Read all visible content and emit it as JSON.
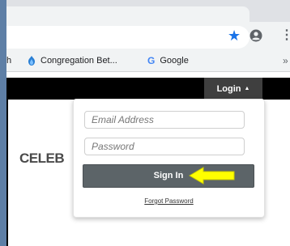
{
  "browser": {
    "bookmarks": {
      "truncated_item": "h",
      "items": [
        {
          "label": "Congregation Bet...",
          "icon": "congregation-flame-icon"
        },
        {
          "label": "Google",
          "icon": "google-g-icon"
        }
      ],
      "overflow": "»"
    },
    "toolbar": {
      "star_icon": "bookmark-star-icon",
      "profile_icon": "account-circle-icon",
      "menu_icon": "kebab-menu-icon"
    }
  },
  "site": {
    "nav": {
      "login_label": "Login",
      "login_caret": "▲"
    },
    "headline": "CELEB"
  },
  "login_dropdown": {
    "email_placeholder": "Email Address",
    "password_placeholder": "Password",
    "signin_label": "Sign In",
    "forgot_label": "Forgot Password",
    "annotation": "yellow-arrow-pointing-left"
  },
  "colors": {
    "desktop_bg": "#5e7fa6",
    "nav_bg": "#000000",
    "login_toggle_bg": "#3f3f3f",
    "signin_bg": "#5c6468",
    "arrow_fill": "#ffff00",
    "star": "#1a73e8"
  }
}
